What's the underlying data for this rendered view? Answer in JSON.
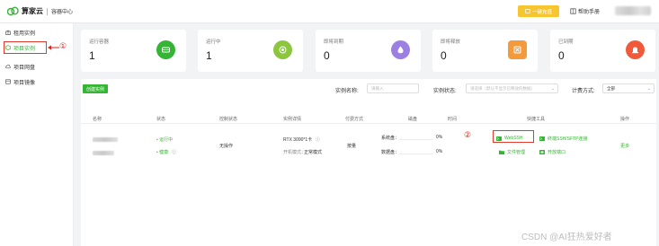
{
  "header": {
    "brand": "算家云",
    "subtitle": "容器中心",
    "recharge_label": "一键充值",
    "help_label": "帮助手册"
  },
  "sidebar": {
    "items": [
      {
        "label": "租用实例",
        "icon": "gift-icon",
        "active": false
      },
      {
        "label": "项目实例",
        "icon": "box-icon",
        "active": true
      },
      {
        "label": "项目网盘",
        "icon": "cloud-icon",
        "active": false
      },
      {
        "label": "项目镜像",
        "icon": "image-icon",
        "active": false
      }
    ],
    "annotation": "①"
  },
  "stats": [
    {
      "label": "运行容器",
      "value": "1",
      "color": "#35b534",
      "icon": "container-icon"
    },
    {
      "label": "运行中",
      "value": "1",
      "color": "#8cc63e",
      "icon": "running-icon"
    },
    {
      "label": "即将到期",
      "value": "0",
      "color": "#9b7fe3",
      "icon": "warning-drop-icon"
    },
    {
      "label": "即将释放",
      "value": "0",
      "color": "#f39a3c",
      "icon": "release-icon"
    },
    {
      "label": "已到期",
      "value": "0",
      "color": "#f05a3a",
      "icon": "alarm-icon"
    }
  ],
  "toolbar": {
    "create_label": "创建实例",
    "name_label": "实例名称:",
    "name_placeholder": "请输入",
    "status_label": "实例状态:",
    "status_placeholder": "请选择（默认不显示已释放的数据）",
    "billing_label": "计费方式:",
    "billing_value": "全部"
  },
  "table": {
    "headers": [
      "名称",
      "状态",
      "控制状态",
      "实例详情",
      "付费方式",
      "磁盘",
      "时间",
      "快捷工具",
      "操作"
    ],
    "row": {
      "status_running": "• 运行中",
      "status_health": "• 健康",
      "control": "无操作",
      "gpu": "RTX 3090*1卡",
      "boot_mode_label": "开机模式：",
      "boot_mode": "正常模式",
      "billing": "按量",
      "system_disk_label": "系统盘：",
      "system_disk_value": "0%",
      "data_disk_label": "数据盘：",
      "data_disk_value": "0%",
      "tools": {
        "webssh": "WebSSH",
        "ssh_sftp": "终端SSH/SFTP连接",
        "file_manager": "文件管理",
        "open_port": "开放端口"
      },
      "action": "更多",
      "annotation": "②"
    }
  },
  "watermark": "CSDN @AI狂热爱好者"
}
